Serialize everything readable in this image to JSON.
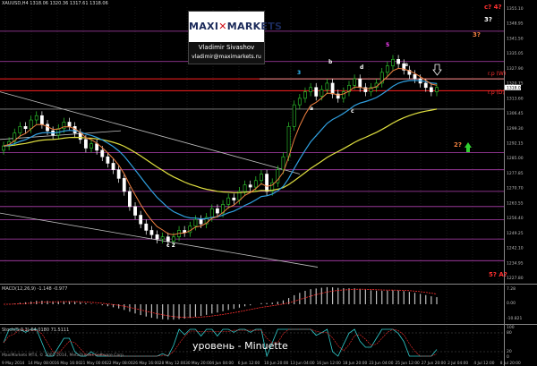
{
  "header": {
    "symbol_line": "XAUUSD,H4  1318.06 1320.36 1317.61 1318.06"
  },
  "logo": {
    "brand_pre": "MAXI",
    "brand_x": "",
    "brand_post": "MARKETS",
    "name": "Vladimir Sivashov",
    "email": "vladimir@maximarkets.ru"
  },
  "caption": "уровень - Minuette",
  "level_labels": {
    "rp_w": "r.p (W)",
    "rp_d": "r.p (D)"
  },
  "wave_labels": {
    "top_c4": "c? 4?",
    "three_q": "3?",
    "two_q_orange": "3?",
    "two_q_mid": "2?",
    "five_a": "5? A?",
    "b": "b",
    "d": "d",
    "e": "e",
    "c_lower": "c",
    "a_mid": "a",
    "three_mid": "3",
    "five_top": "5",
    "c2": "c 2"
  },
  "macd_label": "MACD(12,26,9) -1.148 -0.977",
  "stoch_label": "Stoch(5,3,3) 64.0180 71.5111",
  "price_axis": [
    "1355.10",
    "1348.95",
    "1341.50",
    "1335.05",
    "1327.90",
    "1320.75",
    "1313.60",
    "1306.45",
    "1299.30",
    "1292.15",
    "1285.00",
    "1277.85",
    "1270.70",
    "1263.55",
    "1256.40",
    "1249.25",
    "1242.10",
    "1234.95",
    "1227.80"
  ],
  "macd_axis": [
    "7.28",
    "0.00",
    "-10.821"
  ],
  "stoch_axis": [
    "100",
    "80",
    "20",
    "0"
  ],
  "time_axis": [
    "9 May 2014",
    "14 May 08:00",
    "16 May 16:00",
    "21 May 00:00",
    "22 May 08:00",
    "26 May 16:00",
    "28 May 12:00",
    "30 May 20:00",
    "4 Jun 04:00",
    "6 Jun 12:00",
    "10 Jun 20:00",
    "13 Jun 04:00",
    "16 Jun 12:00",
    "18 Jun 20:00",
    "23 Jun 04:00",
    "25 Jun 12:00",
    "27 Jun 20:00",
    "2 Jul 04:00",
    "4 Jul 12:00",
    "8 Jul 20:00"
  ],
  "footer": "MaxiMarkets MT4, © 2001-2014, MetaQuotes Software Corp.",
  "colors": {
    "ema_fast": "#f08040",
    "ema_mid": "#30a0e0",
    "ema_slow": "#e0e040",
    "resistance": "#ff2020",
    "support_purple": "#b040b0",
    "grid": "#303030"
  },
  "chart_data": {
    "type": "candlestick",
    "instrument": "XAUUSD",
    "timeframe": "H4",
    "ylim": [
      1227.8,
      1355.1
    ],
    "x_range": [
      "9 May 2014",
      "8 Jul 2014"
    ],
    "close": [
      1291,
      1293,
      1297,
      1300,
      1299,
      1303,
      1305,
      1301,
      1298,
      1296,
      1299,
      1302,
      1300,
      1297,
      1294,
      1290,
      1292,
      1289,
      1286,
      1283,
      1280,
      1276,
      1270,
      1263,
      1259,
      1255,
      1252,
      1250,
      1248,
      1249,
      1247,
      1249,
      1252,
      1251,
      1254,
      1257,
      1255,
      1258,
      1262,
      1260,
      1264,
      1267,
      1266,
      1270,
      1273,
      1272,
      1275,
      1278,
      1270,
      1274,
      1280,
      1286,
      1300,
      1310,
      1313,
      1316,
      1318,
      1314,
      1317,
      1320,
      1315,
      1313,
      1316,
      1319,
      1322,
      1318,
      1316,
      1318,
      1320,
      1325,
      1328,
      1331,
      1329,
      1326,
      1324,
      1322,
      1320,
      1318,
      1316,
      1318
    ]
  }
}
